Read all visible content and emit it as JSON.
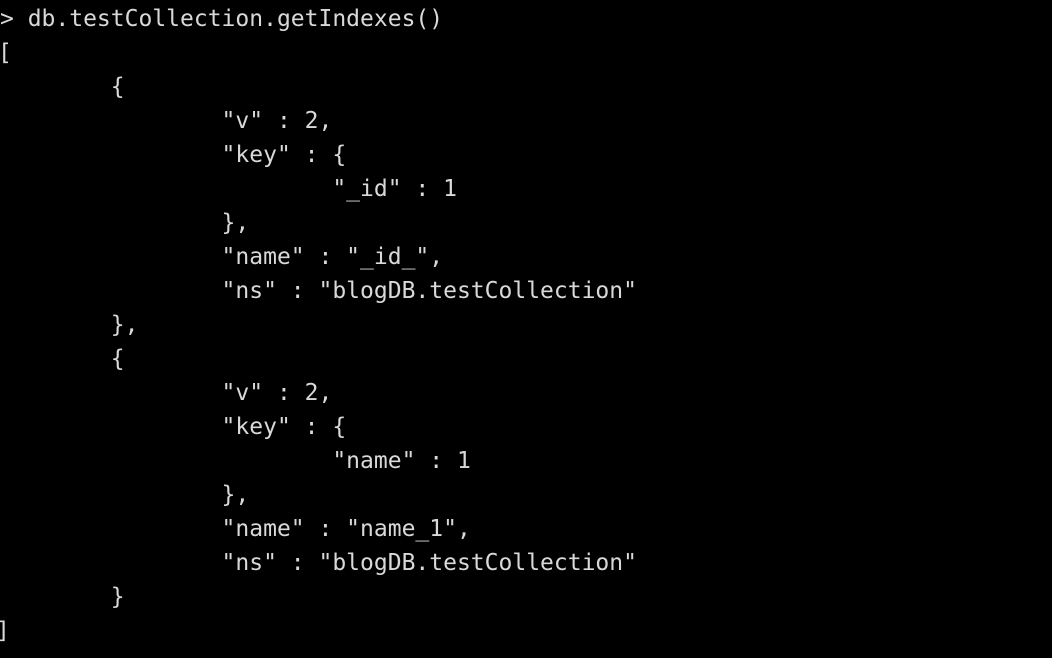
{
  "terminal": {
    "lines": [
      "> db.testCollection.getIndexes()",
      "[",
      "        {",
      "                \"v\" : 2,",
      "                \"key\" : {",
      "                        \"_id\" : 1",
      "                },",
      "                \"name\" : \"_id_\",",
      "                \"ns\" : \"blogDB.testCollection\"",
      "        },",
      "        {",
      "                \"v\" : 2,",
      "                \"key\" : {",
      "                        \"name\" : 1",
      "                },",
      "                \"name\" : \"name_1\",",
      "                \"ns\" : \"blogDB.testCollection\"",
      "        }",
      "]"
    ]
  },
  "colors": {
    "background": "#000000",
    "text": "#d9d9d9"
  }
}
